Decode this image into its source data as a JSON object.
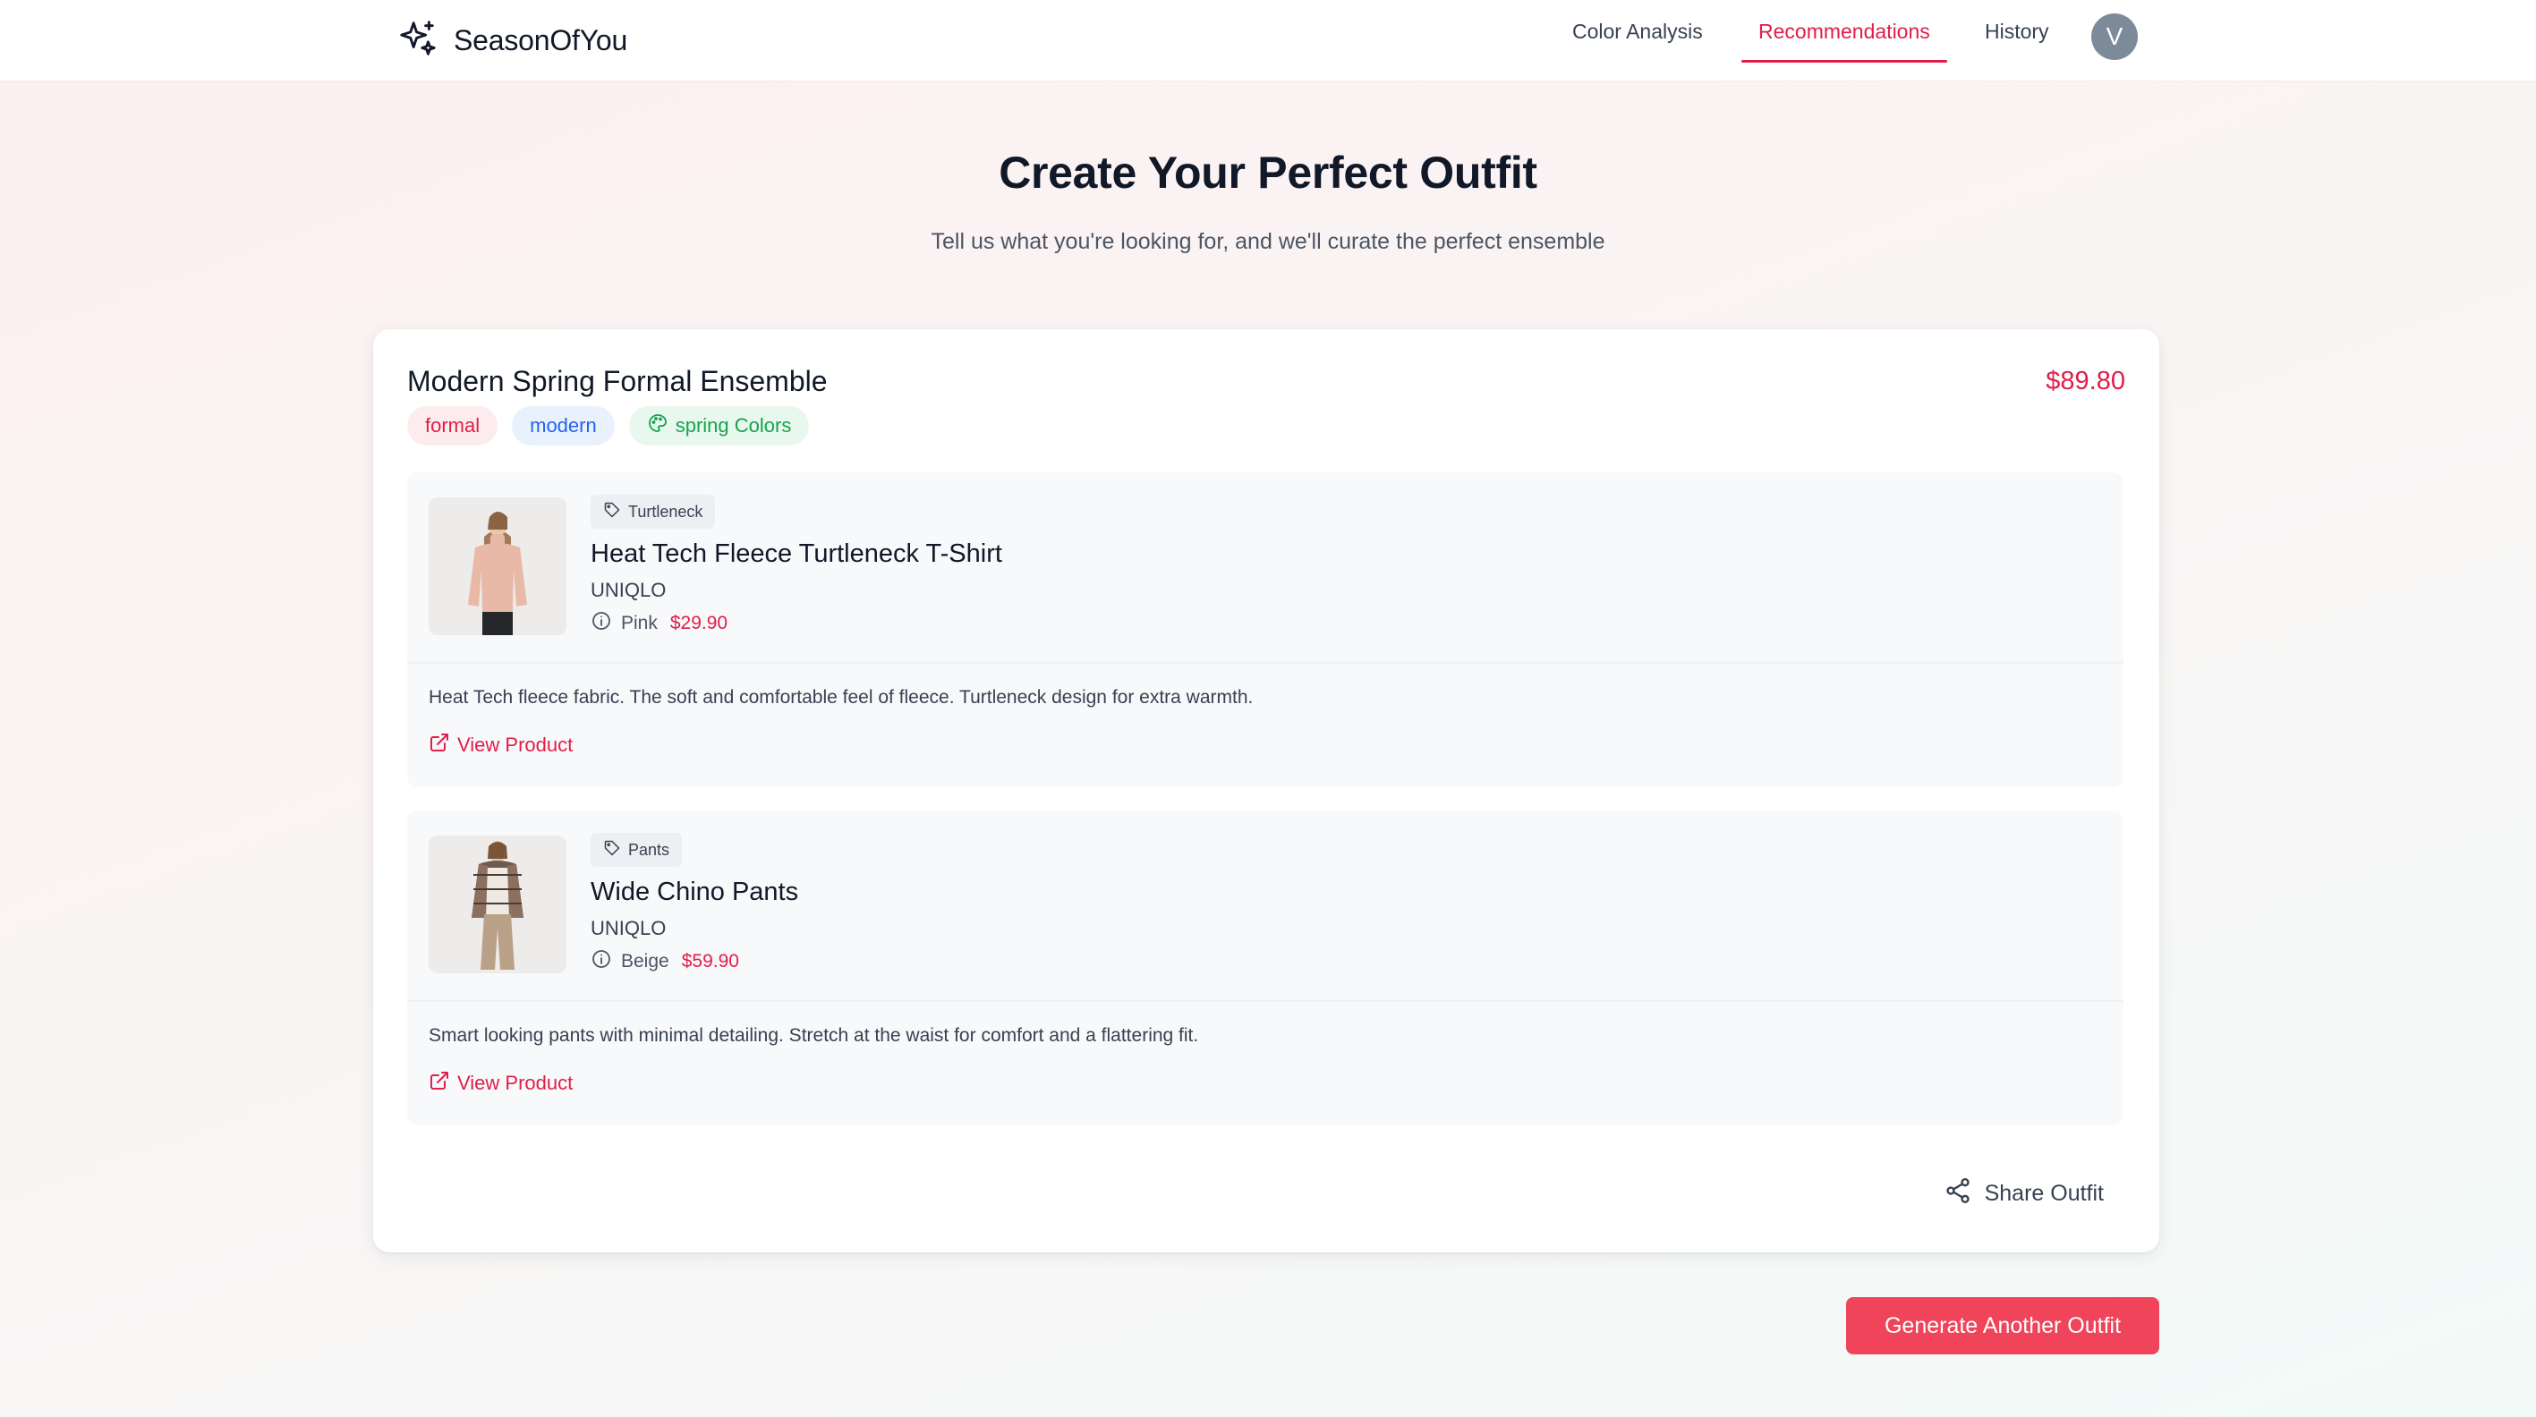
{
  "app": {
    "name": "SeasonOfYou"
  },
  "nav": {
    "items": [
      {
        "label": "Color Analysis",
        "active": false
      },
      {
        "label": "Recommendations",
        "active": true
      },
      {
        "label": "History",
        "active": false
      }
    ],
    "avatar_initial": "V"
  },
  "hero": {
    "title": "Create Your Perfect Outfit",
    "subtitle": "Tell us what you're looking for, and we'll curate the perfect ensemble"
  },
  "outfit": {
    "title": "Modern Spring Formal Ensemble",
    "total_price": "$89.80",
    "tags": [
      {
        "label": "formal",
        "icon": ""
      },
      {
        "label": "modern",
        "icon": ""
      },
      {
        "label": "spring Colors",
        "icon": "palette-icon"
      }
    ],
    "items": [
      {
        "category": "Turtleneck",
        "name": "Heat Tech Fleece Turtleneck T-Shirt",
        "brand": "UNIQLO",
        "color": "Pink",
        "price": "$29.90",
        "description": "Heat Tech fleece fabric. The soft and comfortable feel of fleece. Turtleneck design for extra warmth.",
        "link_label": "View Product",
        "swatch": "#e8b9a6"
      },
      {
        "category": "Pants",
        "name": "Wide Chino Pants",
        "brand": "UNIQLO",
        "color": "Beige",
        "price": "$59.90",
        "description": "Smart looking pants with minimal detailing. Stretch at the waist for comfort and a flattering fit.",
        "link_label": "View Product",
        "swatch": "#b8a186"
      }
    ],
    "share_label": "Share Outfit"
  },
  "actions": {
    "generate_label": "Generate Another Outfit"
  },
  "colors": {
    "accent": "#e11d48",
    "button": "#ef4459"
  }
}
